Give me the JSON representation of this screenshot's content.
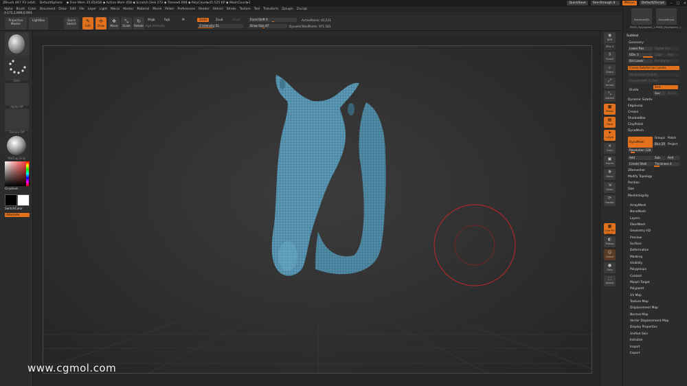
{
  "titlebar": {
    "app": "ZBrush 4R7 P3 (x64)",
    "doc": "DefaultSphere",
    "stats": "◆ Free Mem 35.654GB ◆ Active Mem 458 ◆ Scratch Disk 272 ◆ Timer▸0.008 ◆ PolyCount▸45.525 KP ◆ MeshCount▸1",
    "quicksave": "QuickSave",
    "seethrough": "See-through 0",
    "menus": "Menus",
    "script": "DefaultZScript"
  },
  "menubar": [
    "Alpha",
    "Brush",
    "Color",
    "Document",
    "Draw",
    "Edit",
    "File",
    "Layer",
    "Light",
    "Macro",
    "Marker",
    "Material",
    "Movie",
    "Picker",
    "Preferences",
    "Render",
    "Stencil",
    "Stroke",
    "Texture",
    "Tool",
    "Transform",
    "Zplugin",
    "Zscript"
  ],
  "coords": "0.172,1.689,0.693",
  "shelf": {
    "projection_master": "Projection Master",
    "lightbox": "LightBox",
    "quick_sketch": "Quick Sketch",
    "edit": "Edit",
    "draw": "Draw",
    "move": "Move",
    "scale": "Scale",
    "rotate": "Rotate",
    "mrgb": "Mrgb",
    "rgb": "Rgb",
    "m": "M",
    "rgb_intensity": "Rgb Intensity",
    "zadd": "Zadd",
    "zsub": "Zsub",
    "zcut": "Zcut",
    "z_intensity": "Z Intensity 51",
    "focal_shift": "Focal Shift 0",
    "draw_size": "Draw Size 87",
    "dynamic": "Dynamic",
    "active_points": "ActivePoints: 45,531",
    "total_points": "TotalPoints: 971,581"
  },
  "leftshelf": {
    "brush_caption": "Move",
    "stroke_caption": "Dots",
    "alpha_caption": "Alpha Off",
    "texture_caption": "Texture Off",
    "material_caption": "MatCap Gray",
    "gradient": "Gradient",
    "switch_color": "SwitchColor",
    "alternate": "Alternate"
  },
  "watermark": "www.cgmol.com",
  "rightshelf": [
    "BPR",
    "SPix 3",
    "Scroll",
    "Zoom",
    "Actual",
    "AAHalf",
    "Persp",
    "Floor",
    "L.Sym",
    "Gxyz",
    "Frame",
    "Move",
    "Scale",
    "Rotate",
    "Line Fill PolyF",
    "Transp",
    "Ghost",
    "Solo",
    "Xpose"
  ],
  "tray": {
    "tool1": "PolyMesh3D",
    "tool2": "SimpleBrush",
    "tool3": "PM3D_PolySphere_1",
    "tool4": "PM3D_PolySphere_1",
    "subtool": "Subtool",
    "geometry": "Geometry",
    "lower_res": "Lower Res",
    "higher_res": "Higher Res",
    "sdiv": "SDiv 3",
    "cage": "Cage",
    "rstr": "Rstr",
    "del_lower": "Del Lower",
    "del_higher": "Del Higher",
    "freeze_subdivision": "Freeze Subdivision Levels",
    "reconstruct": "Reconstruct Subdiv",
    "convert_bpr": "Convert BPR To Geo",
    "divide": "Divide",
    "smt": "Smt",
    "suv": "Suv",
    "reuv": "ReUV",
    "dynamic_subdiv": "Dynamic Subdiv",
    "edgeloop": "EdgeLoop",
    "crease": "Crease",
    "shadowbox": "ShadowBox",
    "claypolish": "ClayPolish",
    "dynamesh_title": "DynaMesh",
    "dynamesh_btn": "DynaMesh",
    "groups": "Groups",
    "polish": "Polish",
    "blur": "Blur 20",
    "project": "Project",
    "resolution": "Resolution 128",
    "add": "Add",
    "sub": "Sub",
    "and": "And",
    "create_shell": "Create Shell",
    "thickness": "Thickness 4",
    "zremesher": "ZRemesher",
    "modify_topology": "Modify Topology",
    "position": "Position",
    "size": "Size",
    "meshintegrity": "MeshIntegrity"
  },
  "tool_menu": [
    "ArrayMesh",
    "NanoMesh",
    "Layers",
    "FiberMesh",
    "Geometry HD",
    "Preview",
    "Surface",
    "Deformation",
    "Masking",
    "Visibility",
    "Polygroups",
    "Contact",
    "Morph Target",
    "Polypaint",
    "UV Map",
    "Texture Map",
    "Displacement Map",
    "Normal Map",
    "Vector Displacement Map",
    "Display Properties",
    "Unified Skin",
    "Initialize",
    "Import",
    "Export"
  ],
  "colors": {
    "accent": "#e2711d",
    "mesh": "#5b9ab5",
    "brush_ring": "#c0282a"
  }
}
